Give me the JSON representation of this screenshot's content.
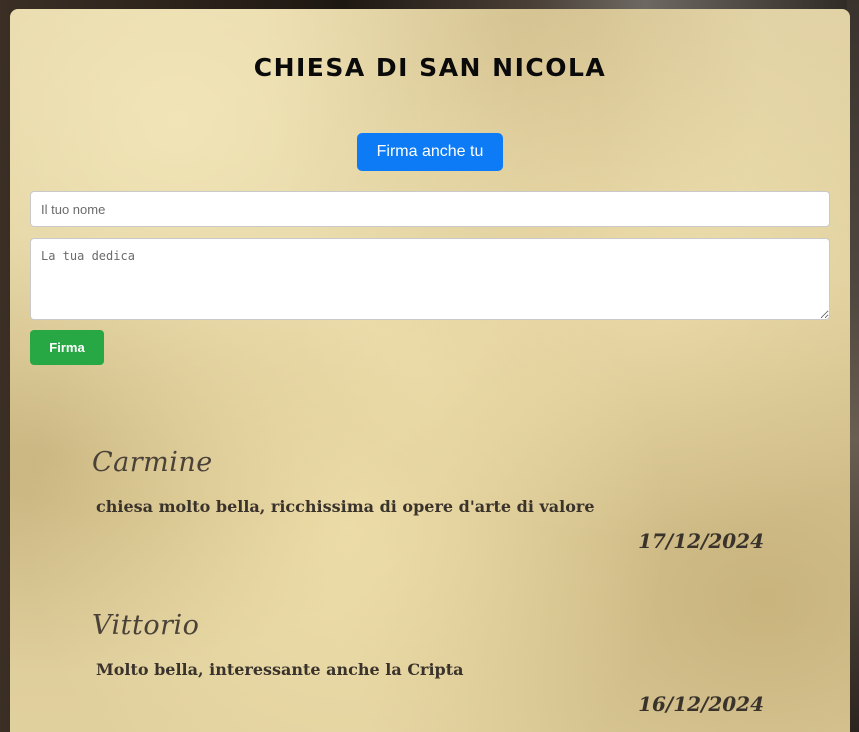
{
  "page": {
    "title": "CHIESA DI SAN NICOLA"
  },
  "form": {
    "toggle_label": "Firma anche tu",
    "name_placeholder": "Il tuo nome",
    "dedica_placeholder": "La tua dedica",
    "submit_label": "Firma"
  },
  "entries": [
    {
      "author": "Carmine",
      "message": "chiesa molto bella, ricchissima di opere d'arte di valore",
      "date": "17/12/2024"
    },
    {
      "author": "Vittorio",
      "message": "Molto bella, interessante anche la Cripta",
      "date": "16/12/2024"
    }
  ],
  "colors": {
    "primary_button": "#0d7bf5",
    "submit_button": "#28a745",
    "parchment": "#e2d3a6"
  }
}
